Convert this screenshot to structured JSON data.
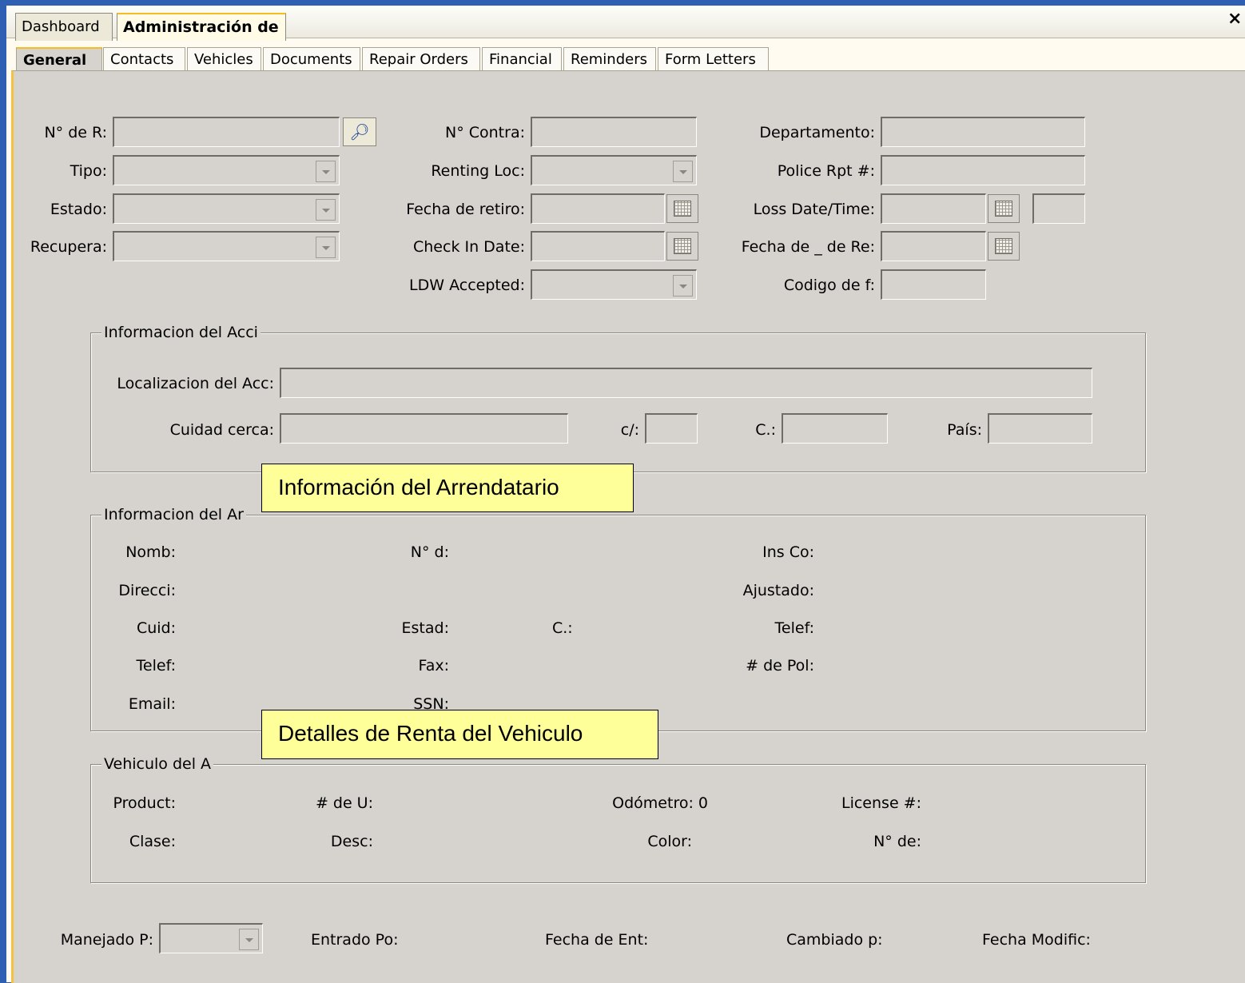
{
  "window": {
    "tabs": [
      "Dashboard",
      "Administración de"
    ],
    "active_tab": "Administración de",
    "close_glyph": "×"
  },
  "subtabs": [
    "General",
    "Contacts",
    "Vehicles",
    "Documents",
    "Repair Orders",
    "Financial",
    "Reminders",
    "Form Letters"
  ],
  "general": {
    "col1": {
      "nro_label": "N° de R:",
      "tipo_label": "Tipo:",
      "estado_label": "Estado:",
      "recupera_label": "Recupera:"
    },
    "col2": {
      "contra_label": "N° Contra:",
      "renting_label": "Renting Loc:",
      "retiro_label": "Fecha de retiro:",
      "checkin_label": "Check In Date:",
      "ldw_label": "LDW Accepted:"
    },
    "col3": {
      "depto_label": "Departamento:",
      "police_label": "Police Rpt #:",
      "loss_label": "Loss Date/Time:",
      "fechare_label": "Fecha de _ de Re:",
      "codigo_label": "Codigo de f:"
    }
  },
  "accidente": {
    "title": "Informacion del Acci",
    "localizacion_label": "Localizacion del Acc:",
    "ciudad_label": "Cuidad cerca:",
    "c_label": "c/:",
    "cp_label": "C.:",
    "pais_label": "País:"
  },
  "arrendatario": {
    "title": "Informacion del Ar",
    "nomb": "Nomb:",
    "direcci": "Direcci:",
    "cuid": "Cuid:",
    "telef": "Telef:",
    "email": "Email:",
    "nd": "N° d:",
    "estad": "Estad:",
    "c": "C.:",
    "fax": "Fax:",
    "ssn": "SSN:",
    "insco": "Ins Co:",
    "ajustado": "Ajustado:",
    "telef2": "Telef:",
    "pol": "# de Pol:"
  },
  "vehiculo": {
    "title": "Vehiculo del A",
    "product": "Product:",
    "clase": "Clase:",
    "unidad": "# de U:",
    "desc": "Desc:",
    "odometro": "Odómetro: 0",
    "color": "Color:",
    "license": "License #:",
    "nde": "N° de:"
  },
  "footer": {
    "manejado": "Manejado P:",
    "entrado": "Entrado Po:",
    "fecha_ent": "Fecha de Ent:",
    "cambiado": "Cambiado p:",
    "fecha_mod": "Fecha Modific:"
  },
  "callouts": {
    "arrendatario": "Información del Arrendatario",
    "renta": "Detalles de Renta del Vehiculo"
  },
  "colors": {
    "panel": "#d6d3ce",
    "accent": "#f4bd23",
    "callout": "#ffff99",
    "desktop": "#2f5fb3"
  }
}
